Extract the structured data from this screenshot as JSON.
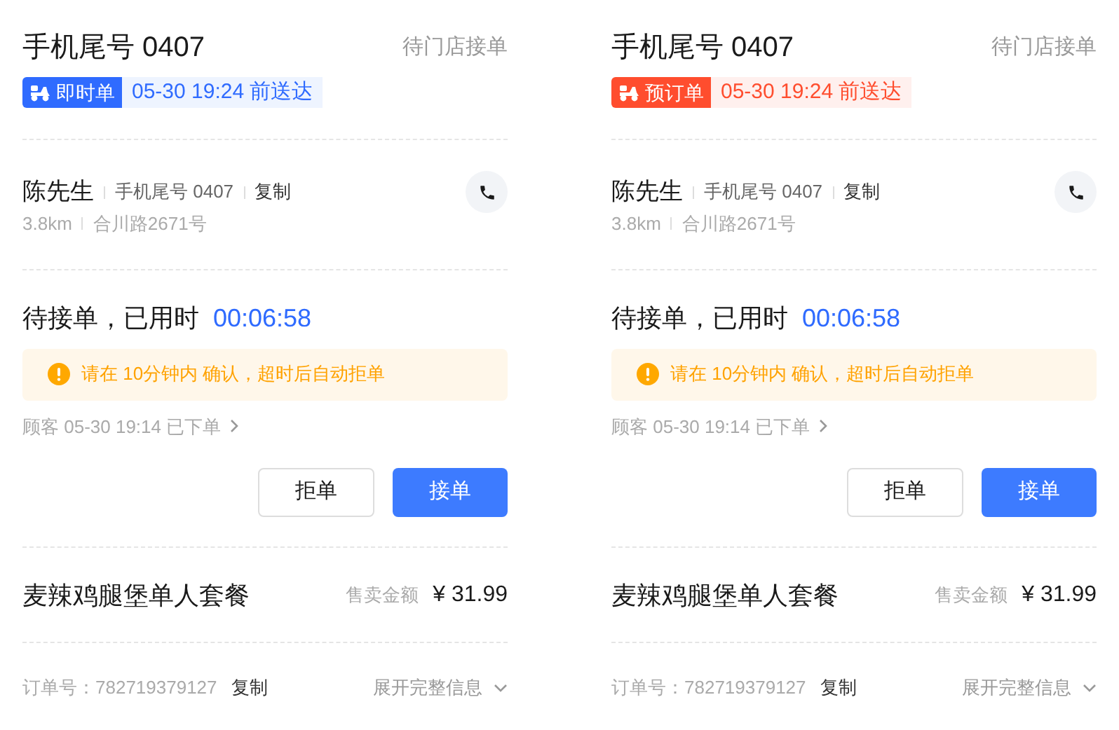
{
  "orders": [
    {
      "title": "手机尾号 0407",
      "status": "待门店接单",
      "tag": {
        "kind": "instant",
        "label": "即时单",
        "deadline": "05-30 19:24 前送达"
      },
      "customer": {
        "name": "陈先生",
        "phone": "手机尾号 0407",
        "copy": "复制",
        "distance": "3.8km",
        "address": "合川路2671号"
      },
      "waiting": {
        "label": "待接单，已用时",
        "timer": "00:06:58"
      },
      "warning": "请在 10分钟内 确认，超时后自动拒单",
      "placed": "顾客 05-30 19:14 已下单",
      "buttons": {
        "reject": "拒单",
        "accept": "接单"
      },
      "product": {
        "name": "麦辣鸡腿堡单人套餐",
        "price_label": "售卖金额",
        "price": "¥ 31.99"
      },
      "order_no": {
        "label": "订单号：",
        "value": "782719379127",
        "copy": "复制"
      },
      "expand": "展开完整信息"
    },
    {
      "title": "手机尾号 0407",
      "status": "待门店接单",
      "tag": {
        "kind": "reserved",
        "label": "预订单",
        "deadline": "05-30 19:24 前送达"
      },
      "customer": {
        "name": "陈先生",
        "phone": "手机尾号 0407",
        "copy": "复制",
        "distance": "3.8km",
        "address": "合川路2671号"
      },
      "waiting": {
        "label": "待接单，已用时",
        "timer": "00:06:58"
      },
      "warning": "请在 10分钟内 确认，超时后自动拒单",
      "placed": "顾客 05-30 19:14 已下单",
      "buttons": {
        "reject": "拒单",
        "accept": "接单"
      },
      "product": {
        "name": "麦辣鸡腿堡单人套餐",
        "price_label": "售卖金额",
        "price": "¥ 31.99"
      },
      "order_no": {
        "label": "订单号：",
        "value": "782719379127",
        "copy": "复制"
      },
      "expand": "展开完整信息"
    }
  ]
}
